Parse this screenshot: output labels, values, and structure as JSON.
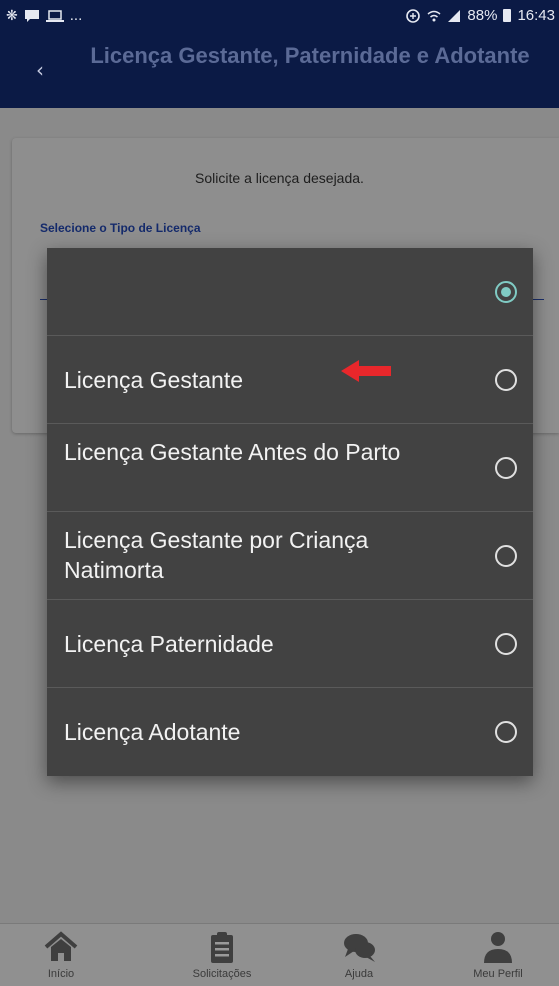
{
  "status_bar": {
    "left_icons": [
      "whatsapp-icon",
      "message-icon",
      "laptop-icon"
    ],
    "ellipsis": "...",
    "sync_icon": "sync-icon",
    "wifi_icon": "wifi-icon",
    "signal_icon": "signal-icon",
    "battery_percent": "88%",
    "time": "16:43"
  },
  "header": {
    "back_icon": "chevron-left-icon",
    "title": "Licença Gestante, Paternidade e Adotante"
  },
  "content": {
    "intro": "Solicite a licença desejada.",
    "field_label": "Selecione o Tipo de Licença"
  },
  "dialog": {
    "options": [
      {
        "label": "",
        "selected": true
      },
      {
        "label": "Licença Gestante",
        "selected": false
      },
      {
        "label": "Licença Gestante Antes do Parto",
        "selected": false
      },
      {
        "label": "Licença Gestante por Criança Natimorta",
        "selected": false
      },
      {
        "label": "Licença Paternidade",
        "selected": false
      },
      {
        "label": "Licença Adotante",
        "selected": false
      }
    ],
    "annotation_color": "#e8272b"
  },
  "tab_bar": {
    "items": [
      {
        "label": "Início",
        "icon": "home-icon"
      },
      {
        "label": "Solicitações",
        "icon": "clipboard-icon"
      },
      {
        "label": "Ajuda",
        "icon": "chat-icon"
      },
      {
        "label": "Meu Perfil",
        "icon": "user-icon"
      }
    ]
  },
  "colors": {
    "header_bg": "#0b1a45",
    "dialog_bg": "#424242",
    "radio_selected": "#80cbc4"
  }
}
